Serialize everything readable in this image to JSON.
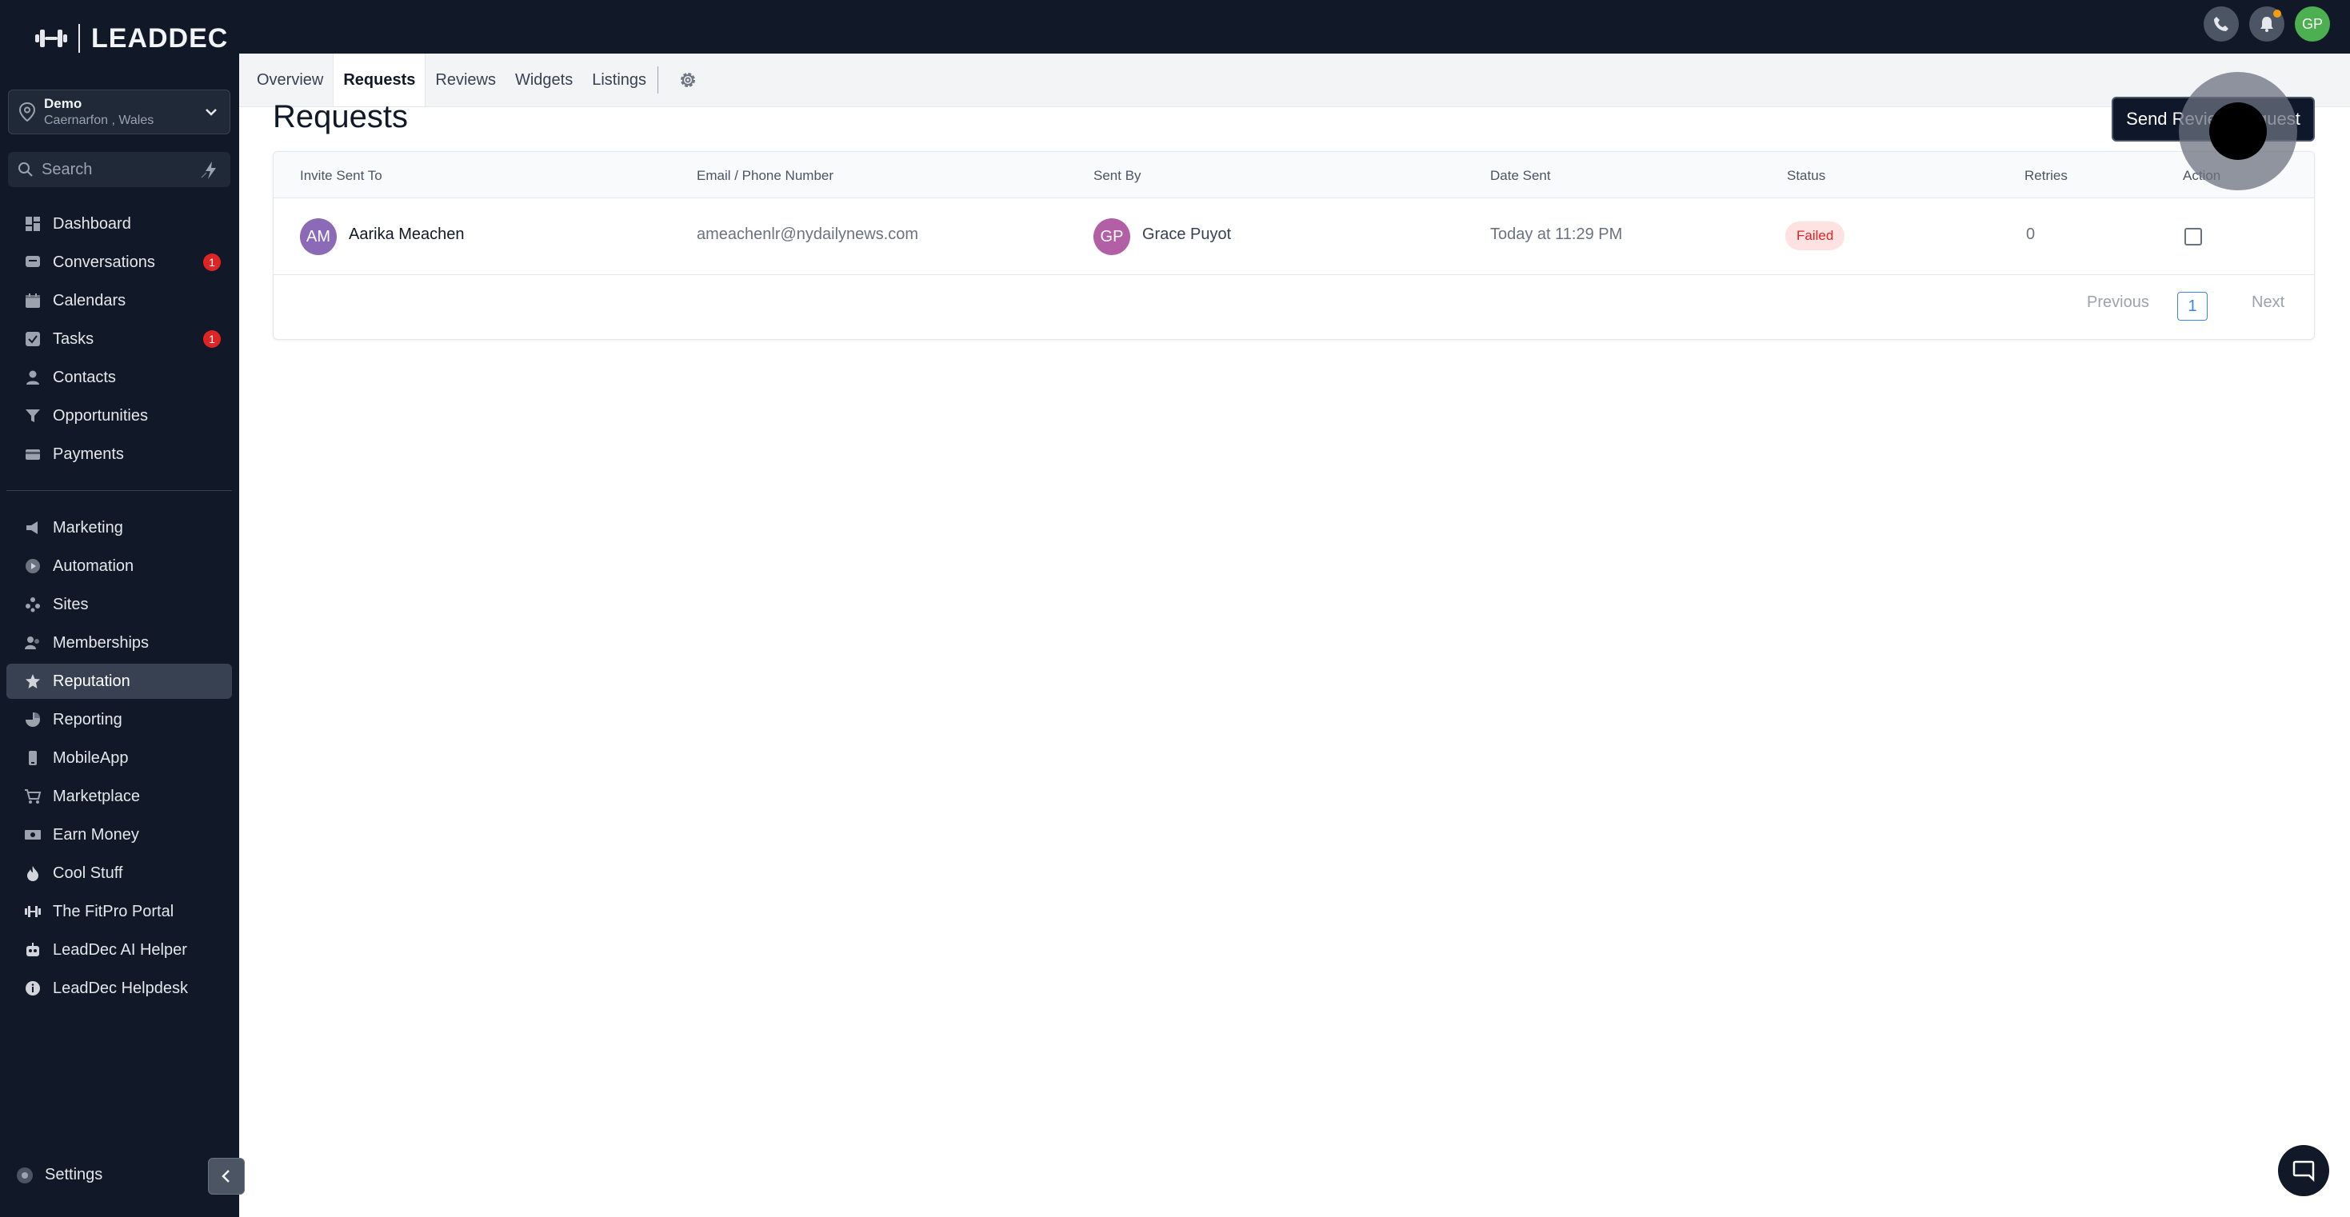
{
  "brand": {
    "logo_text": "LEADDEC"
  },
  "location": {
    "name": "Demo",
    "address": "Caernarfon , Wales"
  },
  "search": {
    "placeholder": "Search"
  },
  "sidebar": {
    "items": [
      {
        "label": "Dashboard",
        "icon": "dashboard-icon"
      },
      {
        "label": "Conversations",
        "icon": "chat-icon",
        "badge": "1"
      },
      {
        "label": "Calendars",
        "icon": "calendar-icon"
      },
      {
        "label": "Tasks",
        "icon": "checkbox-icon",
        "badge": "1"
      },
      {
        "label": "Contacts",
        "icon": "person-icon"
      },
      {
        "label": "Opportunities",
        "icon": "filter-icon"
      },
      {
        "label": "Payments",
        "icon": "card-icon"
      }
    ],
    "items2": [
      {
        "label": "Marketing",
        "icon": "megaphone-icon"
      },
      {
        "label": "Automation",
        "icon": "automation-icon"
      },
      {
        "label": "Sites",
        "icon": "sites-icon"
      },
      {
        "label": "Memberships",
        "icon": "members-icon"
      },
      {
        "label": "Reputation",
        "icon": "star-icon",
        "active": true
      },
      {
        "label": "Reporting",
        "icon": "chart-icon"
      },
      {
        "label": "MobileApp",
        "icon": "mobile-icon"
      },
      {
        "label": "Marketplace",
        "icon": "cart-icon"
      },
      {
        "label": "Earn Money",
        "icon": "money-icon"
      },
      {
        "label": "Cool Stuff",
        "icon": "flame-icon"
      },
      {
        "label": "The FitPro Portal",
        "icon": "dumbbell-icon"
      },
      {
        "label": "LeadDec AI Helper",
        "icon": "robot-icon"
      },
      {
        "label": "LeadDec Helpdesk",
        "icon": "info-icon"
      }
    ],
    "settings_label": "Settings"
  },
  "topbar": {
    "user_initials": "GP"
  },
  "tabs": [
    {
      "label": "Overview"
    },
    {
      "label": "Requests",
      "active": true
    },
    {
      "label": "Reviews"
    },
    {
      "label": "Widgets"
    },
    {
      "label": "Listings"
    }
  ],
  "page": {
    "title": "Requests",
    "send_button": "Send Review Request"
  },
  "table": {
    "headers": [
      "Invite Sent To",
      "Email / Phone Number",
      "Sent By",
      "Date Sent",
      "Status",
      "Retries",
      "Action"
    ],
    "rows": [
      {
        "invitee_initials": "AM",
        "invitee_name": "Aarika Meachen",
        "email": "ameachenlr@nydailynews.com",
        "sender_initials": "GP",
        "sender_name": "Grace Puyot",
        "date_sent": "Today at 11:29 PM",
        "status": "Failed",
        "retries": "0"
      }
    ]
  },
  "pagination": {
    "previous": "Previous",
    "page": "1",
    "next": "Next"
  },
  "colors": {
    "sidebar_bg": "#111827",
    "accent": "#3b82f6",
    "failed_text": "#dc2626",
    "failed_bg": "#fee2e2",
    "invitee_avatar": "#8b6bb8",
    "sender_avatar": "#b35fa6",
    "user_avatar": "#4caf50"
  }
}
